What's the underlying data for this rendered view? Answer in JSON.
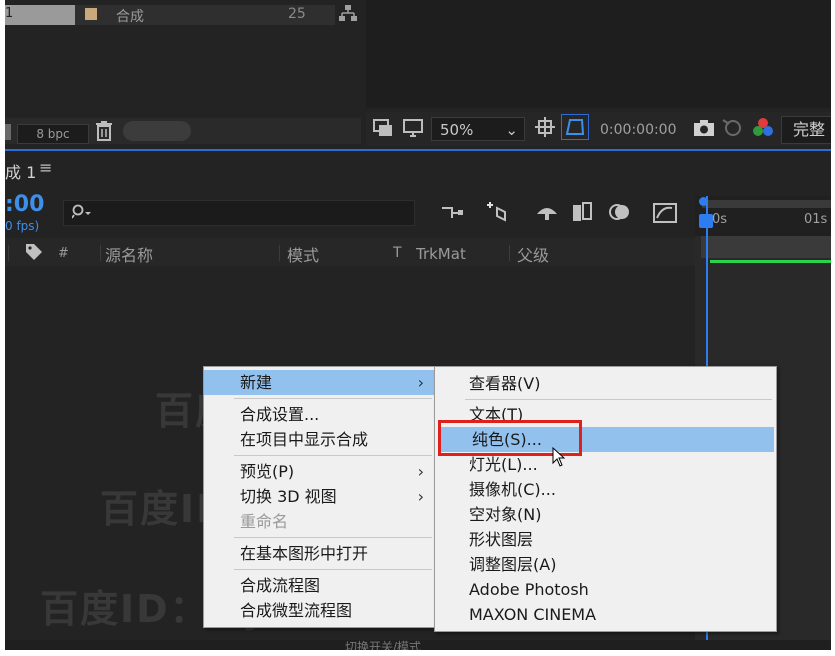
{
  "project": {
    "row_index": "1",
    "comp_name": "合成",
    "comp_value": "25",
    "bpc": "8 bpc"
  },
  "viewer": {
    "zoom": "50%",
    "timecode": "0:00:00:00",
    "quality": "完整"
  },
  "timeline": {
    "tab_title": "成 1",
    "tab_menu": "≡",
    "current_time": ":00",
    "fps": "0 fps)",
    "col_hash": "#",
    "col_source_name": "源名称",
    "col_mode": "模式",
    "col_t": "T",
    "col_trkmat": "TrkMat",
    "col_parent": "父级",
    "ruler_0": "0s",
    "ruler_1": "01s",
    "footer": "切换开关/模式"
  },
  "watermark": {
    "line1": "百度ID：ffjczr",
    "line2": "百度ID：ffjczr",
    "line3": "百度ID：ffjczr"
  },
  "context_menu": {
    "new": "新建",
    "comp_settings": "合成设置...",
    "reveal_in_project": "在项目中显示合成",
    "preview": "预览(P)",
    "switch_3d_view": "切换 3D 视图",
    "rename": "重命名",
    "open_in_essential_graphics": "在基本图形中打开",
    "comp_flowchart": "合成流程图",
    "comp_mini_flowchart": "合成微型流程图"
  },
  "submenu": {
    "viewer": "查看器(V)",
    "text": "文本(T)",
    "solid": "纯色(S)...",
    "light": "灯光(L)...",
    "camera": "摄像机(C)...",
    "null_object": "空对象(N)",
    "shape_layer": "形状图层",
    "adjustment_layer": "调整图层(A)",
    "adobe_photoshop": "Adobe Photosh",
    "maxon_cinema": "MAXON CINEMA"
  },
  "colors": {
    "accent_blue": "#2d7df0",
    "menu_highlight": "#93c1ee",
    "red_annotation": "#e0201c",
    "track_green": "#2bd24a"
  }
}
